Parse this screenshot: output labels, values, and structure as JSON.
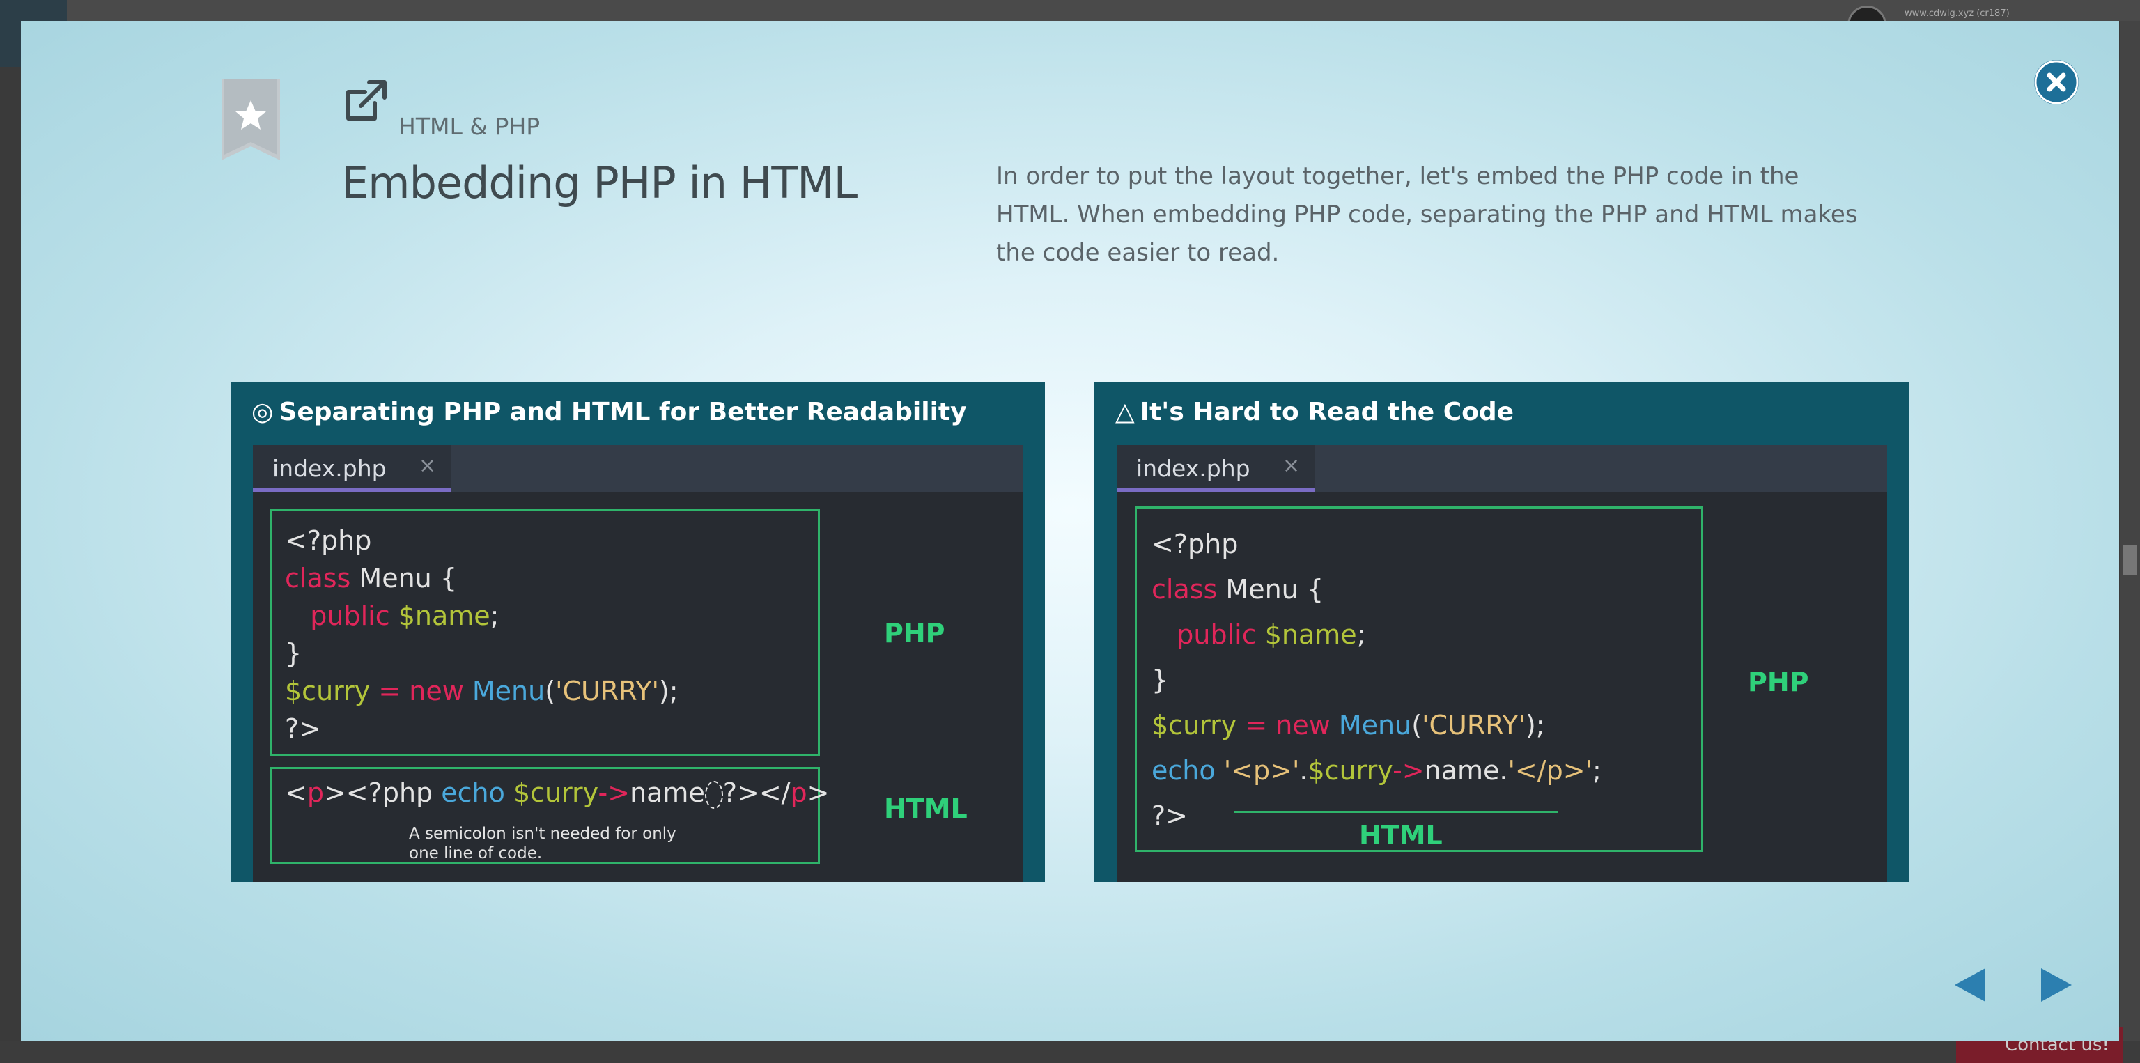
{
  "lesson": {
    "category": "HTML & PHP",
    "title": "Embedding PHP in HTML",
    "description": "In order to put the layout together, let's embed the PHP code in the HTML. When embedding PHP code, separating the PHP and HTML makes the code easier to read."
  },
  "panels": [
    {
      "mark": "◎",
      "heading": "Separating PHP and HTML for Better Readability",
      "tab": "index.php",
      "tab_close": "×",
      "php_label": "PHP",
      "html_label": "HTML",
      "note": "A semicolon isn't needed for only\none line of code."
    },
    {
      "mark": "△",
      "heading": "It's Hard to Read the Code",
      "tab": "index.php",
      "tab_close": "×",
      "php_label": "PHP",
      "html_label": "HTML"
    }
  ],
  "background": {
    "username": "www.cdwlg.xyz (cr187)",
    "contact": "Contact us!"
  },
  "colors": {
    "accent": "#1d6f98",
    "panel": "#0f5667",
    "editor": "#272b31",
    "keyword": "#e0265a",
    "variable": "#b3c53a",
    "function": "#4aa8db",
    "string": "#e7c27a",
    "green_label": "#2fd07a"
  },
  "icons": {
    "bookmark": "bookmark-star-icon",
    "external": "external-link-icon",
    "close": "close-icon",
    "prev": "triangle-left-icon",
    "next": "triangle-right-icon"
  }
}
